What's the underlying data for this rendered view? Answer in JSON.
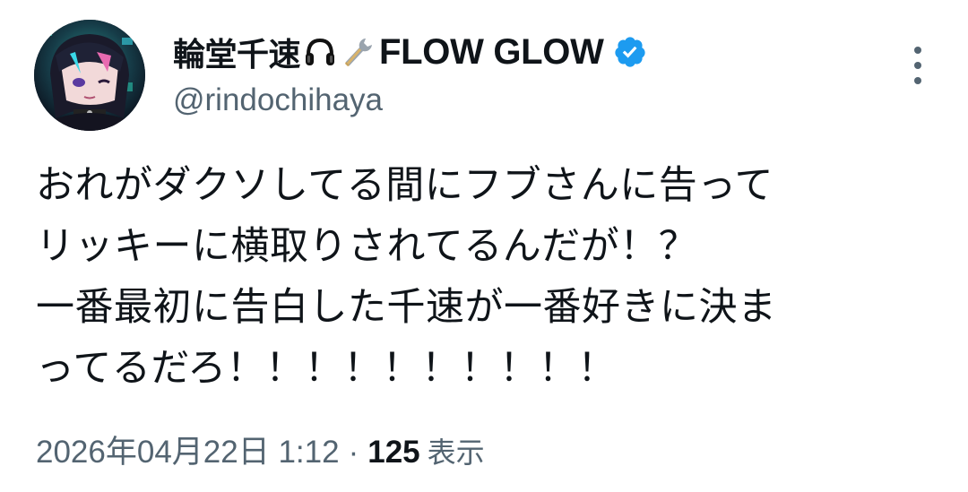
{
  "author": {
    "display_name": "輪堂千速",
    "display_name_tail": "FLOW GLOW",
    "handle": "@rindochihaya",
    "verified": true,
    "emoji": [
      "headphones-icon",
      "wrench-icon"
    ]
  },
  "tweet": {
    "text": "おれがダクソしてる間にフブさんに告って\nリッキーに横取りされてるんだが！？\n一番最初に告白した千速が一番好きに決ま\nってるだろ！！！！！！！！！！",
    "date": "2026年04月22日 1:12",
    "separator": "·",
    "views_count": "125",
    "views_label": "表示"
  },
  "colors": {
    "text": "#0f1419",
    "secondary": "#536471",
    "verified_blue": "#1d9bf0"
  }
}
